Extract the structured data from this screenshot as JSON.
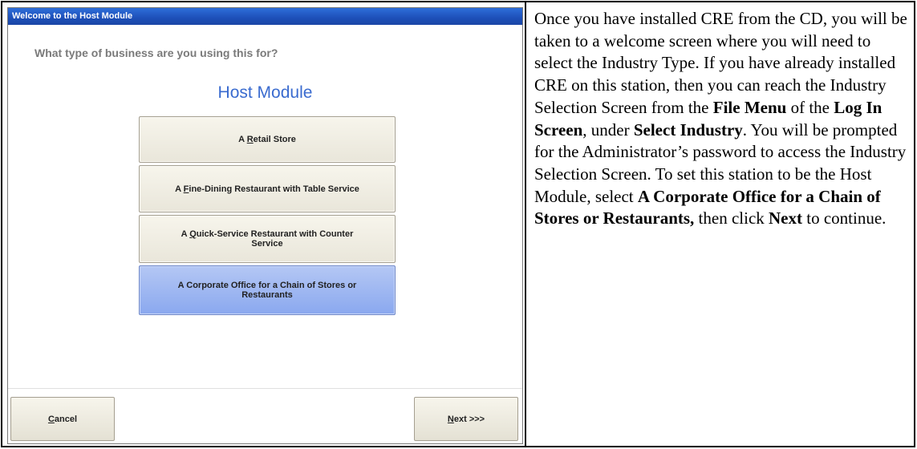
{
  "dialog": {
    "title": "Welcome to the Host Module",
    "question": "What type of business are you using this for?",
    "module_title": "Host Module",
    "options": [
      {
        "pre": "A ",
        "accel": "R",
        "post": "etail Store",
        "selected": false
      },
      {
        "pre": "A ",
        "accel": "F",
        "post": "ine-Dining Restaurant with Table Service",
        "selected": false
      },
      {
        "pre": "A ",
        "accel": "Q",
        "post": "uick-Service Restaurant with Counter Service",
        "selected": false
      },
      {
        "pre": "",
        "accel": "",
        "post": "A Corporate Office for a Chain of Stores or Restaurants",
        "selected": true
      }
    ],
    "cancel": {
      "accel": "C",
      "post": "ancel"
    },
    "next": {
      "accel": "N",
      "post": "ext >>>"
    },
    "colors": {
      "title_bar": "#1d4fb8",
      "module_title": "#3a6bcf",
      "selected_option": "#8aa8ef"
    }
  },
  "instructions": {
    "t1": " Once you have installed CRE from the CD, you will be taken to a welcome screen where you will need to select the Industry Type.  If you have already installed CRE on this station, then you can reach the Industry Selection Screen from the ",
    "b1": "File Menu",
    "t2": " of the ",
    "b2": "Log In Screen",
    "t3": ", under ",
    "b3": "Select Industry",
    "t4": ".  You will be prompted for the Administrator’s password to access the Industry Selection Screen.  To set this station to be the Host Module, select ",
    "b4": "A Corporate Office for a Chain of Stores or Restaurants,",
    "t5": " then click ",
    "b5": "Next",
    "t6": " to continue."
  }
}
